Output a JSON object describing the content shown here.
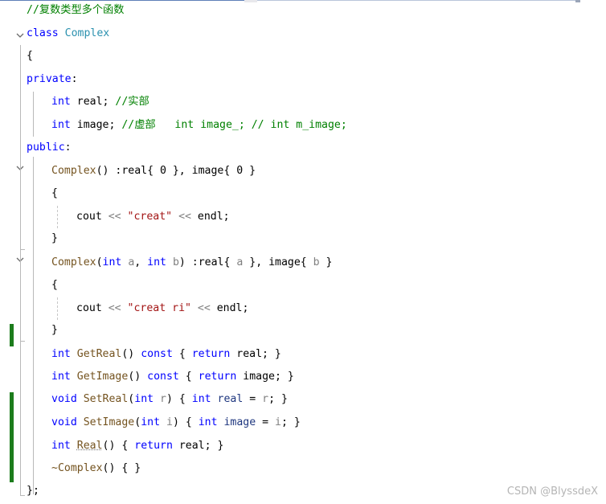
{
  "editor": {
    "lines": [
      {
        "t": [
          {
            "c": "cm",
            "s": "//复数类型多个函数"
          }
        ]
      },
      {
        "t": [
          {
            "c": "kw",
            "s": "class"
          },
          {
            "c": "",
            "s": " "
          },
          {
            "c": "type",
            "s": "Complex"
          }
        ]
      },
      {
        "t": [
          {
            "c": "",
            "s": "{"
          }
        ]
      },
      {
        "t": [
          {
            "c": "kw",
            "s": "private"
          },
          {
            "c": "",
            "s": ":"
          }
        ]
      },
      {
        "t": [
          {
            "c": "kw",
            "s": "int"
          },
          {
            "c": "",
            "s": " real; "
          },
          {
            "c": "cm",
            "s": "//实部"
          }
        ]
      },
      {
        "t": [
          {
            "c": "kw",
            "s": "int"
          },
          {
            "c": "",
            "s": " image; "
          },
          {
            "c": "cm",
            "s": "//虚部   int image_; // int m_image;"
          }
        ]
      },
      {
        "t": [
          {
            "c": "kw",
            "s": "public"
          },
          {
            "c": "",
            "s": ":"
          }
        ]
      },
      {
        "t": [
          {
            "c": "fn",
            "s": "Complex"
          },
          {
            "c": "",
            "s": "() :real{ 0 }, image{ 0 }"
          }
        ]
      },
      {
        "t": [
          {
            "c": "",
            "s": "{"
          }
        ]
      },
      {
        "t": [
          {
            "c": "",
            "s": "cout "
          },
          {
            "c": "pun",
            "s": "<<"
          },
          {
            "c": "",
            "s": " "
          },
          {
            "c": "str",
            "s": "\"creat\""
          },
          {
            "c": "",
            "s": " "
          },
          {
            "c": "pun",
            "s": "<<"
          },
          {
            "c": "",
            "s": " endl;"
          }
        ]
      },
      {
        "t": [
          {
            "c": "",
            "s": "}"
          }
        ]
      },
      {
        "t": [
          {
            "c": "fn",
            "s": "Complex"
          },
          {
            "c": "",
            "s": "("
          },
          {
            "c": "kw",
            "s": "int"
          },
          {
            "c": "",
            "s": " "
          },
          {
            "c": "arg",
            "s": "a"
          },
          {
            "c": "",
            "s": ", "
          },
          {
            "c": "kw",
            "s": "int"
          },
          {
            "c": "",
            "s": " "
          },
          {
            "c": "arg",
            "s": "b"
          },
          {
            "c": "",
            "s": ") :real{ "
          },
          {
            "c": "arg",
            "s": "a"
          },
          {
            "c": "",
            "s": " }, image{ "
          },
          {
            "c": "arg",
            "s": "b"
          },
          {
            "c": "",
            "s": " }"
          }
        ]
      },
      {
        "t": [
          {
            "c": "",
            "s": "{"
          }
        ]
      },
      {
        "t": [
          {
            "c": "",
            "s": "cout "
          },
          {
            "c": "pun",
            "s": "<<"
          },
          {
            "c": "",
            "s": " "
          },
          {
            "c": "str",
            "s": "\"creat ri\""
          },
          {
            "c": "",
            "s": " "
          },
          {
            "c": "pun",
            "s": "<<"
          },
          {
            "c": "",
            "s": " endl;"
          }
        ]
      },
      {
        "t": [
          {
            "c": "",
            "s": "}"
          }
        ]
      },
      {
        "t": [
          {
            "c": "kw",
            "s": "int"
          },
          {
            "c": "",
            "s": " "
          },
          {
            "c": "fn",
            "s": "GetReal"
          },
          {
            "c": "",
            "s": "() "
          },
          {
            "c": "kw",
            "s": "const"
          },
          {
            "c": "",
            "s": " { "
          },
          {
            "c": "kw",
            "s": "return"
          },
          {
            "c": "",
            "s": " real; }"
          }
        ]
      },
      {
        "t": [
          {
            "c": "kw",
            "s": "int"
          },
          {
            "c": "",
            "s": " "
          },
          {
            "c": "fn",
            "s": "GetImage"
          },
          {
            "c": "",
            "s": "() "
          },
          {
            "c": "kw",
            "s": "const"
          },
          {
            "c": "",
            "s": " { "
          },
          {
            "c": "kw",
            "s": "return"
          },
          {
            "c": "",
            "s": " image; }"
          }
        ]
      },
      {
        "t": [
          {
            "c": "kw",
            "s": "void"
          },
          {
            "c": "",
            "s": " "
          },
          {
            "c": "fn",
            "s": "SetReal"
          },
          {
            "c": "",
            "s": "("
          },
          {
            "c": "kw",
            "s": "int"
          },
          {
            "c": "",
            "s": " "
          },
          {
            "c": "arg",
            "s": "r"
          },
          {
            "c": "",
            "s": ") { "
          },
          {
            "c": "kw",
            "s": "int"
          },
          {
            "c": "",
            "s": " "
          },
          {
            "c": "var",
            "s": "real"
          },
          {
            "c": "",
            "s": " = "
          },
          {
            "c": "arg",
            "s": "r"
          },
          {
            "c": "",
            "s": "; }"
          }
        ]
      },
      {
        "t": [
          {
            "c": "kw",
            "s": "void"
          },
          {
            "c": "",
            "s": " "
          },
          {
            "c": "fn",
            "s": "SetImage"
          },
          {
            "c": "",
            "s": "("
          },
          {
            "c": "kw",
            "s": "int"
          },
          {
            "c": "",
            "s": " "
          },
          {
            "c": "arg",
            "s": "i"
          },
          {
            "c": "",
            "s": ") { "
          },
          {
            "c": "kw",
            "s": "int"
          },
          {
            "c": "",
            "s": " "
          },
          {
            "c": "var",
            "s": "image"
          },
          {
            "c": "",
            "s": " = "
          },
          {
            "c": "arg",
            "s": "i"
          },
          {
            "c": "",
            "s": "; }"
          }
        ]
      },
      {
        "t": [
          {
            "c": "kw",
            "s": "int"
          },
          {
            "c": "",
            "s": " "
          },
          {
            "c": "fn squig",
            "s": "Real"
          },
          {
            "c": "",
            "s": "() { "
          },
          {
            "c": "kw",
            "s": "return"
          },
          {
            "c": "",
            "s": " real; }"
          }
        ]
      },
      {
        "t": [
          {
            "c": "fn",
            "s": "~Complex"
          },
          {
            "c": "",
            "s": "() { }"
          }
        ]
      },
      {
        "t": [
          {
            "c": "",
            "s": "};"
          }
        ]
      }
    ]
  },
  "watermark": "CSDN @BlyssdeX",
  "colors": {
    "keyword": "#0000ff",
    "type": "#2b91af",
    "comment": "#008000",
    "string": "#a31515",
    "function": "#74531f",
    "change_bar": "#1c7c1c"
  }
}
